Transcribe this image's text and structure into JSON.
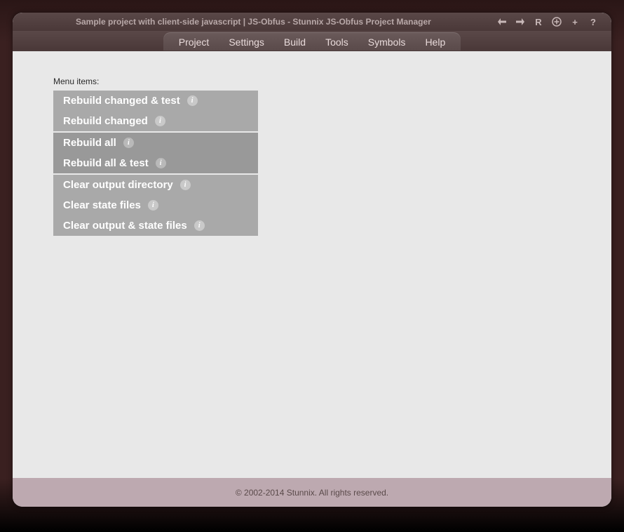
{
  "titlebar": {
    "title": "Sample project with client-side javascript | JS-Obfus - Stunnix JS-Obfus Project Manager",
    "tools": {
      "back": "←",
      "forward": "→",
      "reload": "R",
      "zoom_in_circled": "⊕",
      "plus": "+",
      "help": "?"
    }
  },
  "menubar": {
    "items": [
      {
        "label": "Project"
      },
      {
        "label": "Settings"
      },
      {
        "label": "Build"
      },
      {
        "label": "Tools"
      },
      {
        "label": "Symbols"
      },
      {
        "label": "Help"
      }
    ]
  },
  "content": {
    "section_label": "Menu items:",
    "groups": [
      {
        "shade": "light",
        "items": [
          {
            "label": "Rebuild changed & test"
          },
          {
            "label": "Rebuild changed"
          }
        ]
      },
      {
        "shade": "dark",
        "items": [
          {
            "label": "Rebuild all"
          },
          {
            "label": "Rebuild all & test"
          }
        ]
      },
      {
        "shade": "light",
        "items": [
          {
            "label": "Clear output directory"
          },
          {
            "label": "Clear state files"
          },
          {
            "label": "Clear output & state files"
          }
        ]
      }
    ]
  },
  "footer": {
    "text": "© 2002-2014 Stunnix. All rights reserved."
  }
}
